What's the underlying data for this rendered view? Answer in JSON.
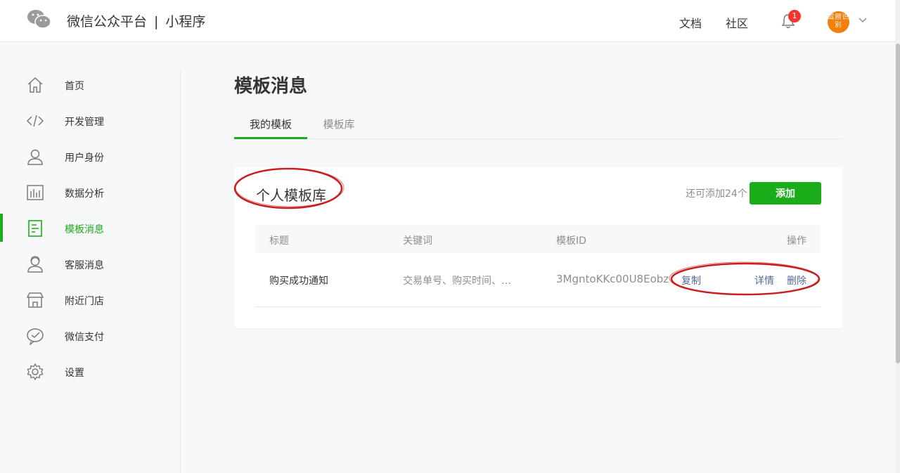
{
  "header": {
    "brand_main": "微信公众平台",
    "brand_sep": "|",
    "brand_sub": "小程序",
    "links": [
      "文档",
      "社区"
    ],
    "notification_count": "1",
    "avatar_text": "驾照识别"
  },
  "sidebar": {
    "items": [
      {
        "label": "首页",
        "icon": "home-icon"
      },
      {
        "label": "开发管理",
        "icon": "code-icon"
      },
      {
        "label": "用户身份",
        "icon": "user-icon"
      },
      {
        "label": "数据分析",
        "icon": "bar-chart-icon"
      },
      {
        "label": "模板消息",
        "icon": "document-icon",
        "active": true
      },
      {
        "label": "客服消息",
        "icon": "customer-service-icon"
      },
      {
        "label": "附近门店",
        "icon": "store-icon"
      },
      {
        "label": "微信支付",
        "icon": "wechat-pay-icon"
      },
      {
        "label": "设置",
        "icon": "gear-icon"
      }
    ]
  },
  "main": {
    "title": "模板消息",
    "tabs": [
      {
        "label": "我的模板",
        "active": true
      },
      {
        "label": "模板库",
        "active": false
      }
    ],
    "card": {
      "title": "个人模板库",
      "remaining": "还可添加24个",
      "add_label": "添加",
      "columns": [
        "标题",
        "关键词",
        "模板ID",
        "操作"
      ],
      "rows": [
        {
          "title": "购买成功通知",
          "keywords": "交易单号、购买时间、…",
          "template_id": "3MgntoKKc00U8Eobz…",
          "actions": [
            "复制",
            "详情",
            "删除"
          ]
        }
      ]
    }
  },
  "colors": {
    "accent": "#1aad19",
    "link": "#576b95",
    "badge": "#f43530",
    "annotation": "#c81e1e"
  }
}
